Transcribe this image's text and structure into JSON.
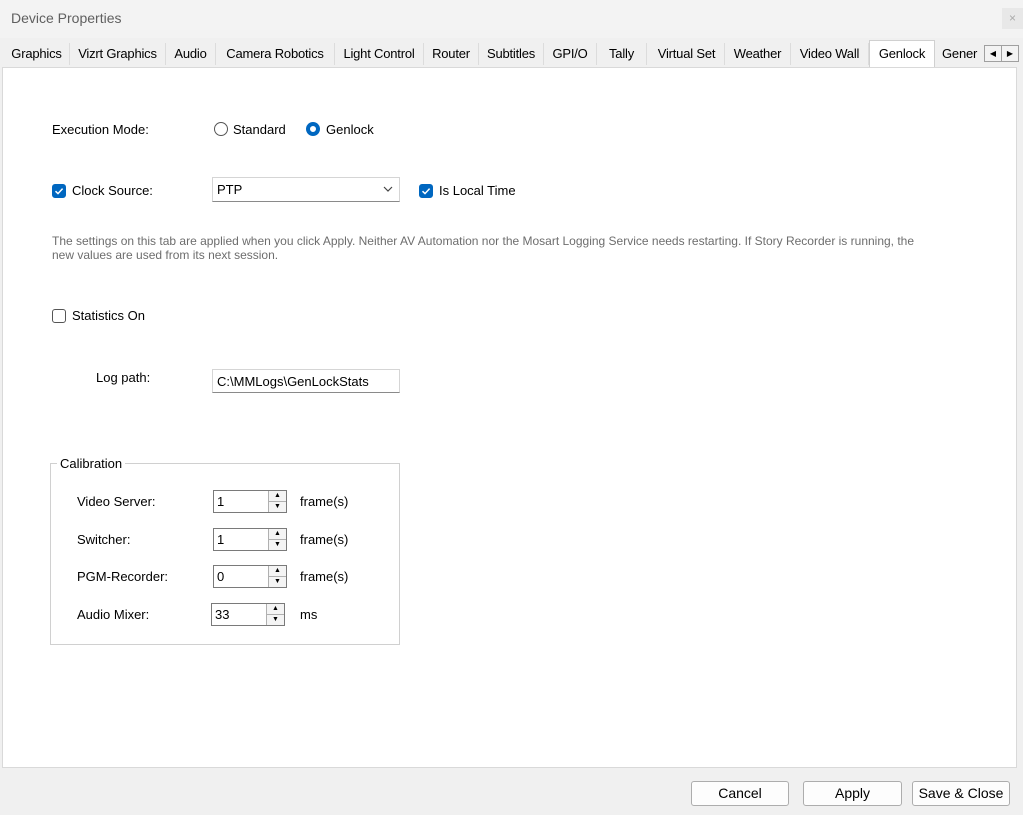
{
  "window": {
    "title": "Device Properties",
    "close_glyph": "×"
  },
  "tabs": [
    {
      "label": "Graphics"
    },
    {
      "label": "Vizrt Graphics"
    },
    {
      "label": "Audio"
    },
    {
      "label": "Camera Robotics"
    },
    {
      "label": "Light Control"
    },
    {
      "label": "Router"
    },
    {
      "label": "Subtitles"
    },
    {
      "label": "GPI/O"
    },
    {
      "label": "Tally"
    },
    {
      "label": "Virtual Set"
    },
    {
      "label": "Weather"
    },
    {
      "label": "Video Wall"
    },
    {
      "label": "Genlock"
    },
    {
      "label": "Gener"
    }
  ],
  "active_tab": "Genlock",
  "execution_mode": {
    "label": "Execution Mode:",
    "options": [
      {
        "label": "Standard",
        "selected": false
      },
      {
        "label": "Genlock",
        "selected": true
      }
    ]
  },
  "clock_source": {
    "label": "Clock Source:",
    "checked": true,
    "value": "PTP",
    "is_local_time": {
      "label": "Is Local Time",
      "checked": true
    }
  },
  "info_text": "The settings on this tab are applied when you click Apply. Neither AV Automation nor the Mosart Logging Service needs restarting. If Story Recorder is running, the new values are used from its next session.",
  "statistics": {
    "label": "Statistics On",
    "checked": false
  },
  "log_path": {
    "label": "Log path:",
    "value": "C:\\MMLogs\\GenLockStats"
  },
  "calibration": {
    "title": "Calibration",
    "rows": [
      {
        "label": "Video Server:",
        "value": "1",
        "unit": "frame(s)"
      },
      {
        "label": "Switcher:",
        "value": "1",
        "unit": "frame(s)"
      },
      {
        "label": "PGM-Recorder:",
        "value": "0",
        "unit": "frame(s)"
      },
      {
        "label": "Audio Mixer:",
        "value": "33",
        "unit": "ms"
      }
    ]
  },
  "buttons": {
    "cancel": "Cancel",
    "apply": "Apply",
    "save_close": "Save & Close"
  },
  "colors": {
    "accent": "#0067c0",
    "info_text": "#6d6d6d",
    "panel": "#ffffff",
    "window": "#f0f0f0"
  },
  "icons": {
    "scroll_left": "chevron-left-icon",
    "scroll_right": "chevron-right-icon",
    "combo": "chevron-down-icon",
    "spin_up": "arrow-up-icon",
    "spin_down": "arrow-down-icon",
    "check": "checkmark-icon"
  }
}
